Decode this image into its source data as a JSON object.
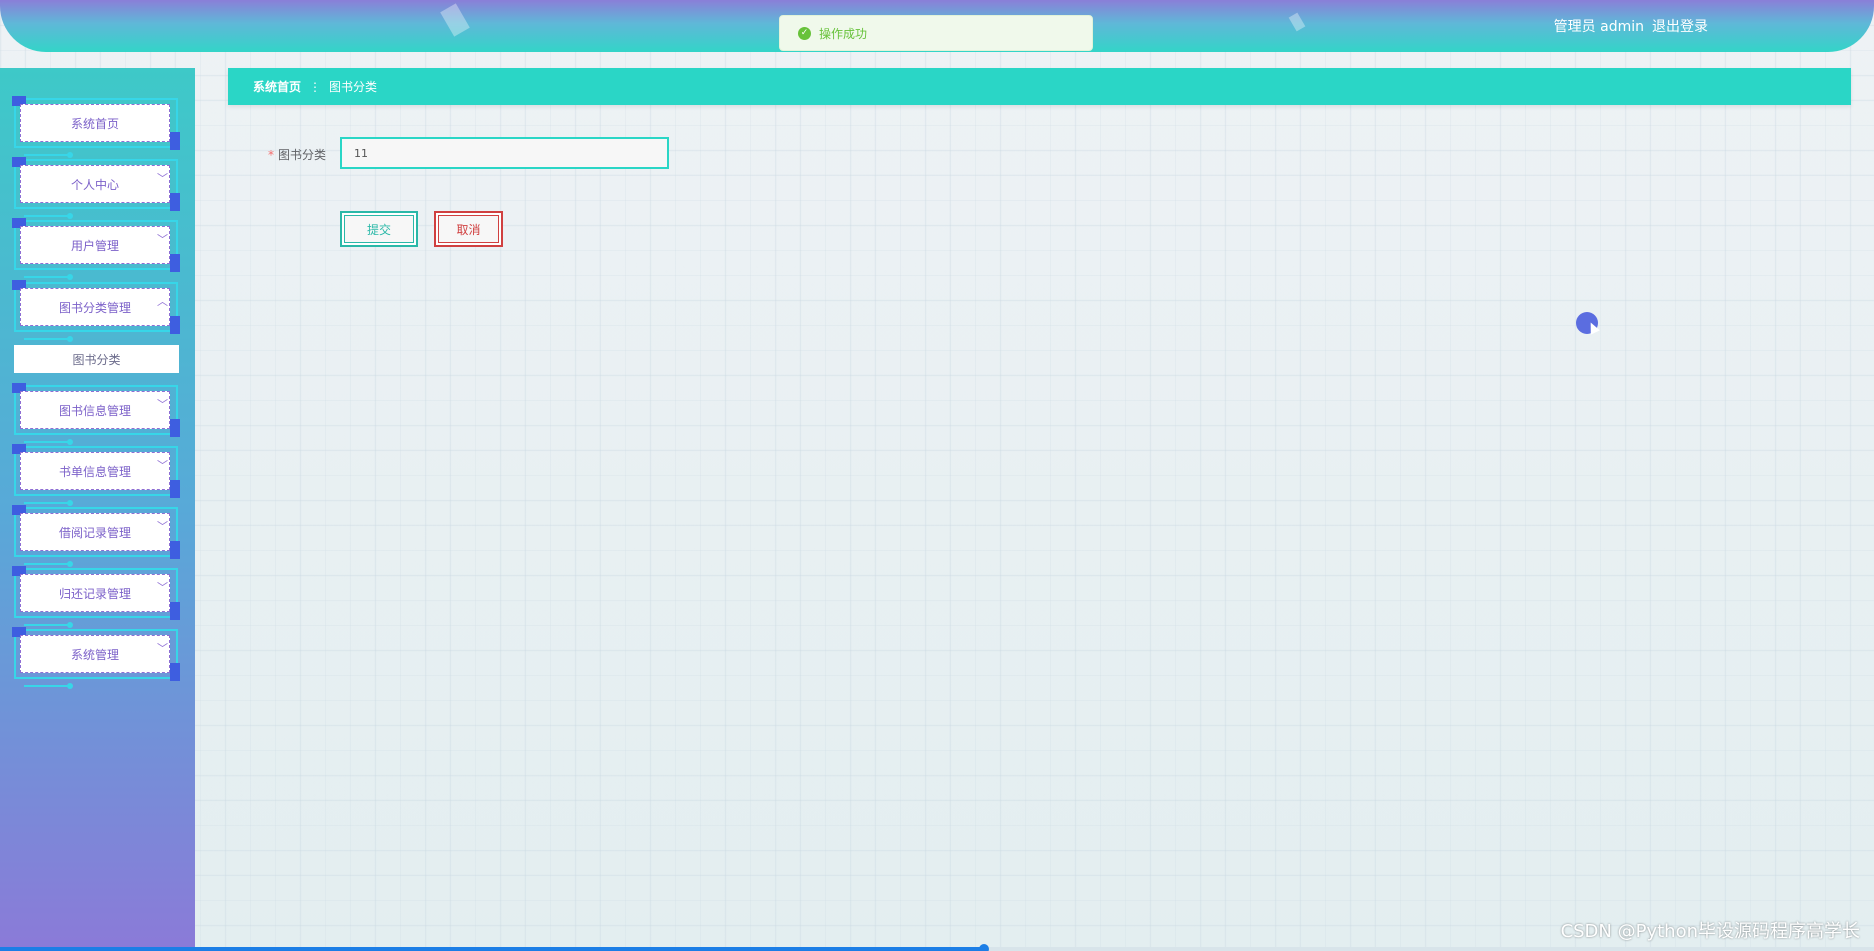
{
  "header": {
    "user_label": "管理员 admin",
    "logout_label": "退出登录"
  },
  "toast": {
    "message": "操作成功",
    "icon": "check-circle-icon",
    "color": "#67c23a"
  },
  "sidebar": {
    "items": [
      {
        "label": "系统首页",
        "chevron": "",
        "icon": ""
      },
      {
        "label": "个人中心",
        "chevron": "﹀",
        "icon": "chevron-down-icon"
      },
      {
        "label": "用户管理",
        "chevron": "﹀",
        "icon": "chevron-down-icon"
      },
      {
        "label": "图书分类管理",
        "chevron": "︿",
        "icon": "chevron-up-icon"
      },
      {
        "label": "图书信息管理",
        "chevron": "﹀",
        "icon": "chevron-down-icon"
      },
      {
        "label": "书单信息管理",
        "chevron": "﹀",
        "icon": "chevron-down-icon"
      },
      {
        "label": "借阅记录管理",
        "chevron": "﹀",
        "icon": "chevron-down-icon"
      },
      {
        "label": "归还记录管理",
        "chevron": "﹀",
        "icon": "chevron-down-icon"
      },
      {
        "label": "系统管理",
        "chevron": "﹀",
        "icon": "chevron-down-icon"
      }
    ],
    "submenu": {
      "label": "图书分类"
    }
  },
  "breadcrumb": {
    "home": "系统首页",
    "separator": "⋮",
    "current": "图书分类"
  },
  "form": {
    "required_mark": "*",
    "field_label": "图书分类",
    "field_value": "11",
    "submit_label": "提交",
    "cancel_label": "取消"
  },
  "page_progress": 0.525,
  "watermark": "CSDN @Python毕设源码程序高学长",
  "colors": {
    "accent": "#2ad6c6",
    "menu_text": "#7c61c9",
    "cancel": "#d04040",
    "submit": "#2ab8a8"
  }
}
